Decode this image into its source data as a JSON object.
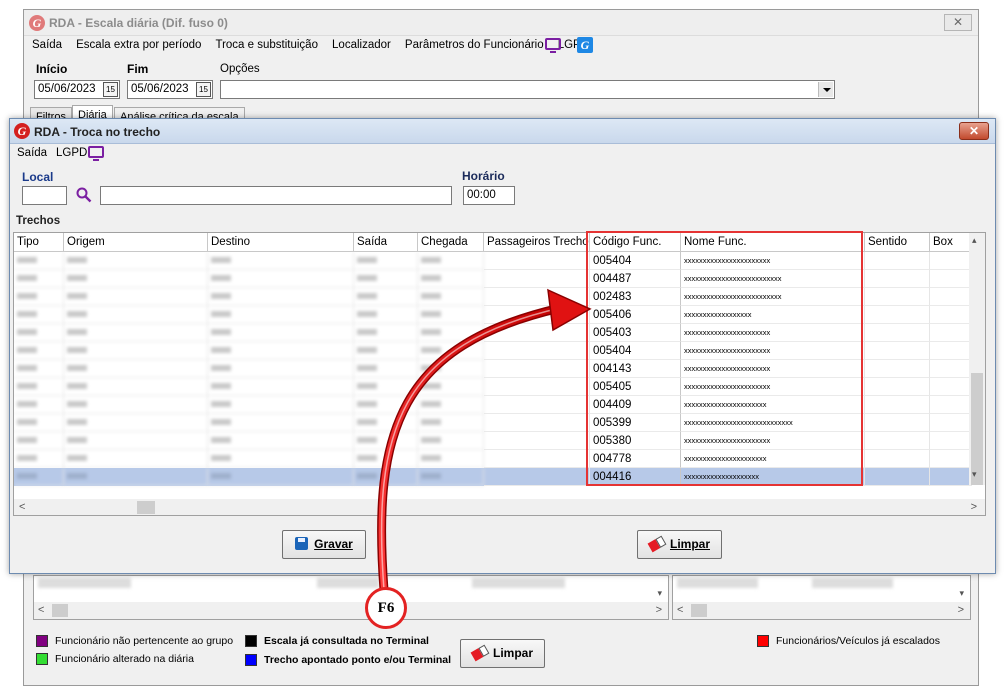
{
  "main_window": {
    "title": "RDA - Escala diária (Dif. fuso 0)",
    "close_label": "✕",
    "menu": [
      "Saída",
      "Escala extra por período",
      "Troca e substituição",
      "Localizador",
      "Parâmetros do Funcionário",
      "LGPD"
    ],
    "inicio_label": "Início",
    "inicio_value": "05/06/2023",
    "fim_label": "Fim",
    "fim_value": "05/06/2023",
    "opcoes_label": "Opções",
    "opcoes_value": "",
    "tabs": [
      "Filtros",
      "Diária",
      "Análise crítica da escala"
    ],
    "limpar_label": "Limpar",
    "legend": {
      "l1": "Funcionário não pertencente ao grupo",
      "l2": "Funcionário alterado na diária",
      "l3": "Escala já consultada no Terminal",
      "l4": "Trecho apontado ponto e/ou Terminal",
      "l5": "Funcionários/Veículos já escalados",
      "c1": "#800080",
      "c2": "#33dd33",
      "c3": "#000000",
      "c4": "#0000ff",
      "c5": "#ff0000"
    }
  },
  "dialog": {
    "title": "RDA - Troca no trecho",
    "close_label": "✕",
    "menu": [
      "Saída",
      "LGPD"
    ],
    "local_label": "Local",
    "local_code": "",
    "local_name": "",
    "horario_label": "Horário",
    "horario_value": "00:00",
    "trechos_label": "Trechos",
    "columns": [
      "Tipo",
      "Origem",
      "Destino",
      "Saída",
      "Chegada",
      "Passageiros Trecho",
      "Código Func.",
      "Nome Func.",
      "Sentido",
      "Box"
    ],
    "rows": [
      {
        "codigo": "005404",
        "nome": "xxxxxxxxxxxxxxxxxxxxxxx"
      },
      {
        "codigo": "004487",
        "nome": "xxxxxxxxxxxxxxxxxxxxxxxxxx"
      },
      {
        "codigo": "002483",
        "nome": "xxxxxxxxxxxxxxxxxxxxxxxxxx"
      },
      {
        "codigo": "005406",
        "nome": "xxxxxxxxxxxxxxxxxx"
      },
      {
        "codigo": "005403",
        "nome": "xxxxxxxxxxxxxxxxxxxxxxx"
      },
      {
        "codigo": "005404",
        "nome": "xxxxxxxxxxxxxxxxxxxxxxx"
      },
      {
        "codigo": "004143",
        "nome": "xxxxxxxxxxxxxxxxxxxxxxx"
      },
      {
        "codigo": "005405",
        "nome": "xxxxxxxxxxxxxxxxxxxxxxx"
      },
      {
        "codigo": "004409",
        "nome": "xxxxxxxxxxxxxxxxxxxxxx"
      },
      {
        "codigo": "005399",
        "nome": "xxxxxxxxxxxxxxxxxxxxxxxxxxxxx"
      },
      {
        "codigo": "005380",
        "nome": "xxxxxxxxxxxxxxxxxxxxxxx"
      },
      {
        "codigo": "004778",
        "nome": "xxxxxxxxxxxxxxxxxxxxxx"
      },
      {
        "codigo": "004416",
        "nome": "xxxxxxxxxxxxxxxxxxxx"
      }
    ],
    "gravar_label": "Gravar",
    "limpar_label": "Limpar"
  },
  "annotation": {
    "key_label": "F6",
    "highlight_color": "#e53333"
  }
}
